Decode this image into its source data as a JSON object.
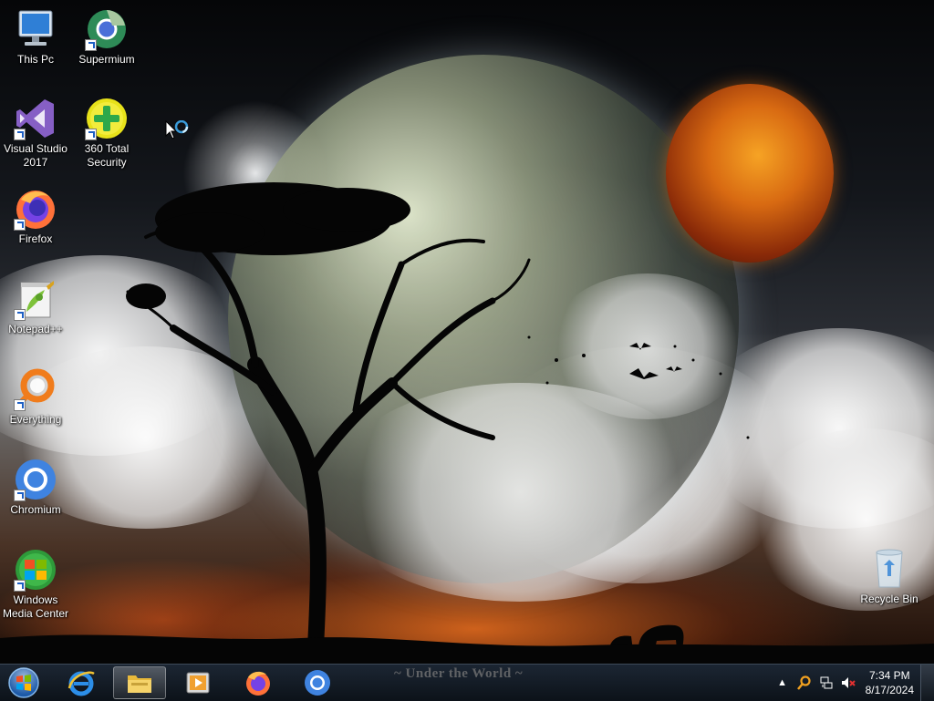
{
  "desktop": {
    "icons": [
      {
        "label": "This Pc"
      },
      {
        "label": "Supermium"
      },
      {
        "label": "Visual Studio\n2017"
      },
      {
        "label": "360 Total\nSecurity"
      },
      {
        "label": "Firefox"
      },
      {
        "label": "Notepad++"
      },
      {
        "label": "Everything"
      },
      {
        "label": "Chromium"
      },
      {
        "label": "Windows\nMedia Center"
      },
      {
        "label": "Recycle Bin"
      }
    ],
    "wallpaper_caption": "~ Under the World ~"
  },
  "taskbar": {
    "start_icon": "windows-start-orb",
    "pinned": [
      {
        "icon": "internet-explorer-icon"
      },
      {
        "icon": "file-explorer-icon",
        "active": true
      },
      {
        "icon": "media-player-icon"
      },
      {
        "icon": "firefox-icon"
      },
      {
        "icon": "chromium-icon"
      }
    ],
    "tray": {
      "time": "7:34 PM",
      "date": "8/17/2024",
      "icons": [
        "show-hidden-arrow-icon",
        "search-tool-icon",
        "network-icon",
        "volume-muted-icon"
      ]
    }
  },
  "colors": {
    "taskbar": "#131b24",
    "planet": "#d86a12",
    "shortcut_arrow": "#1d5fc4"
  }
}
